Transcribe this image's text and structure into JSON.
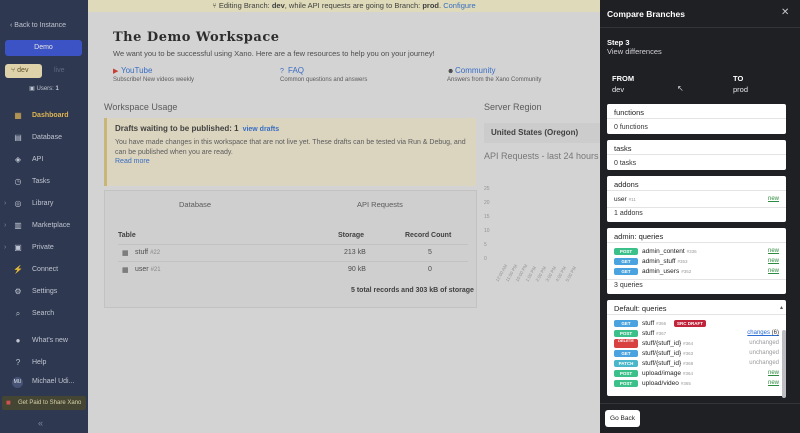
{
  "banner": {
    "prefix": "Editing Branch:",
    "branch": "dev",
    "middle": ", while API requests are going to Branch:",
    "target": "prod",
    "dot": ".",
    "link": "Configure"
  },
  "sidebar": {
    "back": "Back to Instance",
    "workspace": "Demo",
    "branch_active": "dev",
    "branch_other": "live",
    "users_label": "Users:",
    "users_count": "1",
    "nav": [
      {
        "label": "Dashboard",
        "icon": "dashboard-icon",
        "glyph": "▦"
      },
      {
        "label": "Database",
        "icon": "database-icon",
        "glyph": "▤"
      },
      {
        "label": "API",
        "icon": "api-icon",
        "glyph": "◈"
      },
      {
        "label": "Tasks",
        "icon": "clock-icon",
        "glyph": "◷"
      },
      {
        "label": "Library",
        "icon": "library-icon",
        "glyph": "◎"
      },
      {
        "label": "Marketplace",
        "icon": "marketplace-icon",
        "glyph": "▥"
      },
      {
        "label": "Private",
        "icon": "private-icon",
        "glyph": "▣"
      },
      {
        "label": "Connect",
        "icon": "connect-icon",
        "glyph": "⚡"
      },
      {
        "label": "Settings",
        "icon": "gear-icon",
        "glyph": "⚙"
      },
      {
        "label": "Search",
        "icon": "search-icon",
        "glyph": "⌕"
      },
      {
        "label": "What's new",
        "icon": "news-icon",
        "glyph": "●"
      },
      {
        "label": "Help",
        "icon": "help-icon",
        "glyph": "?"
      },
      {
        "label": "Michael Udi...",
        "icon": "avatar",
        "glyph": "MU"
      }
    ],
    "promo": "Get Paid to Share Xano",
    "collapse": "«"
  },
  "workspace": {
    "title": "The Demo Workspace",
    "subtitle": "We want you to be successful using Xano. Here are a few resources to help you on your journey!",
    "resources": [
      {
        "title": "YouTube",
        "desc": "Subscribe! New videos weekly",
        "icon": "youtube-icon"
      },
      {
        "title": "FAQ",
        "desc": "Common questions and answers",
        "icon": "question-icon"
      },
      {
        "title": "Community",
        "desc": "Answers from the Xano Community",
        "icon": "community-icon"
      }
    ],
    "usage_heading": "Workspace Usage",
    "drafts": {
      "title": "Drafts waiting to be published: 1",
      "link": "view drafts",
      "desc": "You have made changes in this workspace that are not live yet. These drafts can be tested via Run & Debug, and can be published when you are ready.",
      "more": "Read more"
    },
    "db_tabs": [
      "Database",
      "API Requests"
    ],
    "db_columns": [
      "Table",
      "Storage",
      "Record Count"
    ],
    "db_rows": [
      {
        "name": "stuff",
        "id": "#22",
        "storage": "213 kB",
        "count": "5"
      },
      {
        "name": "user",
        "id": "#21",
        "storage": "90 kB",
        "count": "0"
      }
    ],
    "db_total": "5 total records and 303 kB of storage",
    "region_heading": "Server Region",
    "region": "United States (Oregon)",
    "api_heading": "API Requests - last 24 hours",
    "chart_ticks": [
      "25",
      "20",
      "15",
      "10",
      "5",
      "0"
    ],
    "chart_x": [
      "12:00 AM",
      "11:00 PM",
      "10:00 PM",
      "1:00 PM",
      "2:00 PM",
      "3:00 PM",
      "4:00 PM",
      "5:00 PM"
    ]
  },
  "panel": {
    "title": "Compare Branches",
    "step_title": "Step 3",
    "step_sub": "View differences",
    "from_label": "FROM",
    "from_value": "dev",
    "to_label": "TO",
    "to_value": "prod",
    "sections": [
      {
        "title": "functions",
        "rows": [],
        "footer": "0 functions"
      },
      {
        "title": "tasks",
        "rows": [],
        "footer": "0 tasks"
      },
      {
        "title": "addons",
        "rows": [
          {
            "verb": "",
            "name": "user",
            "id": "#11",
            "status": "new",
            "statusType": "new"
          }
        ],
        "footer": "1 addons"
      },
      {
        "title": "admin: queries",
        "rows": [
          {
            "verb": "POST",
            "name": "admin_content",
            "id": "#336",
            "status": "new",
            "statusType": "new"
          },
          {
            "verb": "GET",
            "name": "admin_stuff",
            "id": "#353",
            "status": "new",
            "statusType": "new"
          },
          {
            "verb": "GET",
            "name": "admin_users",
            "id": "#352",
            "status": "new",
            "statusType": "new"
          }
        ],
        "footer": "3 queries"
      },
      {
        "title": "Default: queries",
        "rows": [
          {
            "verb": "GET",
            "name": "stuff",
            "id": "#366",
            "badge": "SRC DRAFT",
            "status": "",
            "statusType": ""
          },
          {
            "verb": "POST",
            "name": "stuff",
            "id": "#367",
            "status": "changes",
            "count": "(6)",
            "statusType": "changes"
          },
          {
            "verb": "DELETE",
            "name": "stuff/{stuff_id}",
            "id": "#364",
            "status": "unchanged",
            "statusType": "unchanged"
          },
          {
            "verb": "GET",
            "name": "stuff/{stuff_id}",
            "id": "#363",
            "status": "unchanged",
            "statusType": "unchanged"
          },
          {
            "verb": "PATCH",
            "name": "stuff/{stuff_id}",
            "id": "#368",
            "status": "unchanged",
            "statusType": "unchanged"
          },
          {
            "verb": "POST",
            "name": "upload/image",
            "id": "#364",
            "status": "new",
            "statusType": "new"
          },
          {
            "verb": "POST",
            "name": "upload/video",
            "id": "#365",
            "status": "new",
            "statusType": "new"
          }
        ],
        "footer": ""
      }
    ],
    "go_back": "Go Back"
  },
  "colors": {
    "sidebar": "#1e2a47",
    "accent": "#2f4bd6",
    "panel": "#1f2024",
    "new": "#2d8a3e",
    "draft": "#c0243a"
  }
}
